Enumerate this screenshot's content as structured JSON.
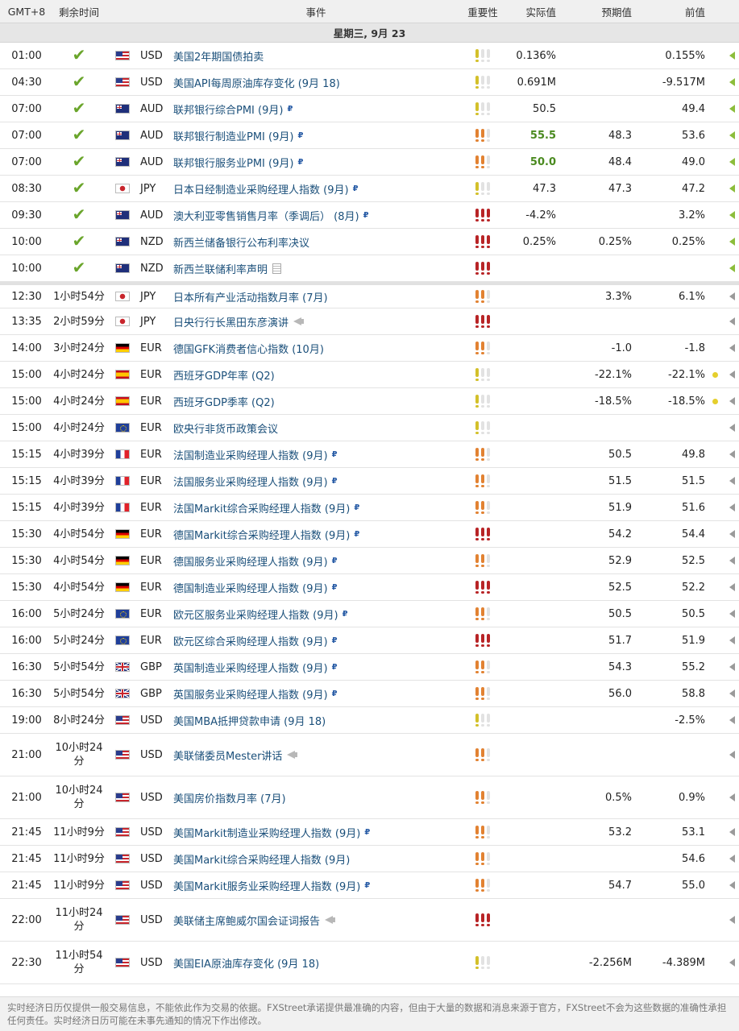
{
  "header": {
    "tz": "GMT+8",
    "remaining": "剩余时间",
    "event": "事件",
    "importance": "重要性",
    "actual": "实际值",
    "forecast": "预期值",
    "previous": "前值"
  },
  "day_label": "星期三, 9月 23",
  "rows": [
    {
      "time": "01:00",
      "rem": "",
      "done": true,
      "flag": "us",
      "cur": "USD",
      "event": "美国2年期国债拍卖",
      "mark": "",
      "imp": 1,
      "actual": "0.136%",
      "actual_green": false,
      "forecast": "",
      "previous": "0.155%",
      "dot": false,
      "arrow": "green"
    },
    {
      "time": "04:30",
      "rem": "",
      "done": true,
      "flag": "us",
      "cur": "USD",
      "event": "美国API每周原油库存变化 (9月 18)",
      "mark": "",
      "imp": 1,
      "actual": "0.691M",
      "actual_green": false,
      "forecast": "",
      "previous": "-9.517M",
      "dot": false,
      "arrow": "green"
    },
    {
      "time": "07:00",
      "rem": "",
      "done": true,
      "flag": "au",
      "cur": "AUD",
      "event": "联邦银行综合PMI (9月)",
      "mark": "P",
      "imp": 1,
      "actual": "50.5",
      "actual_green": false,
      "forecast": "",
      "previous": "49.4",
      "dot": false,
      "arrow": "green"
    },
    {
      "time": "07:00",
      "rem": "",
      "done": true,
      "flag": "au",
      "cur": "AUD",
      "event": "联邦银行制造业PMI (9月)",
      "mark": "P",
      "imp": 2,
      "actual": "55.5",
      "actual_green": true,
      "forecast": "48.3",
      "previous": "53.6",
      "dot": false,
      "arrow": "green"
    },
    {
      "time": "07:00",
      "rem": "",
      "done": true,
      "flag": "au",
      "cur": "AUD",
      "event": "联邦银行服务业PMI (9月)",
      "mark": "P",
      "imp": 2,
      "actual": "50.0",
      "actual_green": true,
      "forecast": "48.4",
      "previous": "49.0",
      "dot": false,
      "arrow": "green"
    },
    {
      "time": "08:30",
      "rem": "",
      "done": true,
      "flag": "jp",
      "cur": "JPY",
      "event": "日本日经制造业采购经理人指数 (9月)",
      "mark": "P",
      "imp": 1,
      "actual": "47.3",
      "actual_green": false,
      "forecast": "47.3",
      "previous": "47.2",
      "dot": false,
      "arrow": "green"
    },
    {
      "time": "09:30",
      "rem": "",
      "done": true,
      "flag": "au",
      "cur": "AUD",
      "event": "澳大利亚零售销售月率（季调后） (8月)",
      "mark": "P",
      "imp": 3,
      "actual": "-4.2%",
      "actual_green": false,
      "forecast": "",
      "previous": "3.2%",
      "dot": false,
      "arrow": "green"
    },
    {
      "time": "10:00",
      "rem": "",
      "done": true,
      "flag": "nz",
      "cur": "NZD",
      "event": "新西兰储备银行公布利率决议",
      "mark": "",
      "imp": 3,
      "actual": "0.25%",
      "actual_green": false,
      "forecast": "0.25%",
      "previous": "0.25%",
      "dot": false,
      "arrow": "green"
    },
    {
      "time": "10:00",
      "rem": "",
      "done": true,
      "flag": "nz",
      "cur": "NZD",
      "event": "新西兰联储利率声明",
      "mark": "doc",
      "imp": 3,
      "actual": "",
      "actual_green": false,
      "forecast": "",
      "previous": "",
      "dot": false,
      "arrow": "green"
    },
    {
      "time": "12:30",
      "rem": "1小时54分",
      "done": false,
      "flag": "jp",
      "cur": "JPY",
      "event": "日本所有产业活动指数月率 (7月)",
      "mark": "",
      "imp": 2,
      "actual": "",
      "actual_green": false,
      "forecast": "3.3%",
      "previous": "6.1%",
      "dot": false,
      "arrow": "gray",
      "sep": true
    },
    {
      "time": "13:35",
      "rem": "2小时59分",
      "done": false,
      "flag": "jp",
      "cur": "JPY",
      "event": "日央行行长黑田东彦演讲",
      "mark": "mega",
      "imp": 3,
      "actual": "",
      "actual_green": false,
      "forecast": "",
      "previous": "",
      "dot": false,
      "arrow": "gray"
    },
    {
      "time": "14:00",
      "rem": "3小时24分",
      "done": false,
      "flag": "de",
      "cur": "EUR",
      "event": "德国GFK消费者信心指数 (10月)",
      "mark": "",
      "imp": 2,
      "actual": "",
      "actual_green": false,
      "forecast": "-1.0",
      "previous": "-1.8",
      "dot": false,
      "arrow": "gray"
    },
    {
      "time": "15:00",
      "rem": "4小时24分",
      "done": false,
      "flag": "es",
      "cur": "EUR",
      "event": "西班牙GDP年率 (Q2)",
      "mark": "",
      "imp": 1,
      "actual": "",
      "actual_green": false,
      "forecast": "-22.1%",
      "previous": "-22.1%",
      "dot": true,
      "arrow": "gray"
    },
    {
      "time": "15:00",
      "rem": "4小时24分",
      "done": false,
      "flag": "es",
      "cur": "EUR",
      "event": "西班牙GDP季率 (Q2)",
      "mark": "",
      "imp": 1,
      "actual": "",
      "actual_green": false,
      "forecast": "-18.5%",
      "previous": "-18.5%",
      "dot": true,
      "arrow": "gray"
    },
    {
      "time": "15:00",
      "rem": "4小时24分",
      "done": false,
      "flag": "eu",
      "cur": "EUR",
      "event": "欧央行非货币政策会议",
      "mark": "",
      "imp": 1,
      "actual": "",
      "actual_green": false,
      "forecast": "",
      "previous": "",
      "dot": false,
      "arrow": "gray"
    },
    {
      "time": "15:15",
      "rem": "4小时39分",
      "done": false,
      "flag": "fr",
      "cur": "EUR",
      "event": "法国制造业采购经理人指数 (9月)",
      "mark": "P",
      "imp": 2,
      "actual": "",
      "actual_green": false,
      "forecast": "50.5",
      "previous": "49.8",
      "dot": false,
      "arrow": "gray"
    },
    {
      "time": "15:15",
      "rem": "4小时39分",
      "done": false,
      "flag": "fr",
      "cur": "EUR",
      "event": "法国服务业采购经理人指数 (9月)",
      "mark": "P",
      "imp": 2,
      "actual": "",
      "actual_green": false,
      "forecast": "51.5",
      "previous": "51.5",
      "dot": false,
      "arrow": "gray"
    },
    {
      "time": "15:15",
      "rem": "4小时39分",
      "done": false,
      "flag": "fr",
      "cur": "EUR",
      "event": "法国Markit综合采购经理人指数 (9月)",
      "mark": "P",
      "imp": 2,
      "actual": "",
      "actual_green": false,
      "forecast": "51.9",
      "previous": "51.6",
      "dot": false,
      "arrow": "gray"
    },
    {
      "time": "15:30",
      "rem": "4小时54分",
      "done": false,
      "flag": "de",
      "cur": "EUR",
      "event": "德国Markit综合采购经理人指数 (9月)",
      "mark": "P",
      "imp": 3,
      "actual": "",
      "actual_green": false,
      "forecast": "54.2",
      "previous": "54.4",
      "dot": false,
      "arrow": "gray"
    },
    {
      "time": "15:30",
      "rem": "4小时54分",
      "done": false,
      "flag": "de",
      "cur": "EUR",
      "event": "德国服务业采购经理人指数 (9月)",
      "mark": "P",
      "imp": 2,
      "actual": "",
      "actual_green": false,
      "forecast": "52.9",
      "previous": "52.5",
      "dot": false,
      "arrow": "gray"
    },
    {
      "time": "15:30",
      "rem": "4小时54分",
      "done": false,
      "flag": "de",
      "cur": "EUR",
      "event": "德国制造业采购经理人指数 (9月)",
      "mark": "P",
      "imp": 3,
      "actual": "",
      "actual_green": false,
      "forecast": "52.5",
      "previous": "52.2",
      "dot": false,
      "arrow": "gray"
    },
    {
      "time": "16:00",
      "rem": "5小时24分",
      "done": false,
      "flag": "eu",
      "cur": "EUR",
      "event": "欧元区服务业采购经理人指数 (9月)",
      "mark": "P",
      "imp": 2,
      "actual": "",
      "actual_green": false,
      "forecast": "50.5",
      "previous": "50.5",
      "dot": false,
      "arrow": "gray"
    },
    {
      "time": "16:00",
      "rem": "5小时24分",
      "done": false,
      "flag": "eu",
      "cur": "EUR",
      "event": "欧元区综合采购经理人指数 (9月)",
      "mark": "P",
      "imp": 3,
      "actual": "",
      "actual_green": false,
      "forecast": "51.7",
      "previous": "51.9",
      "dot": false,
      "arrow": "gray"
    },
    {
      "time": "16:30",
      "rem": "5小时54分",
      "done": false,
      "flag": "gb",
      "cur": "GBP",
      "event": "英国制造业采购经理人指数 (9月)",
      "mark": "P",
      "imp": 2,
      "actual": "",
      "actual_green": false,
      "forecast": "54.3",
      "previous": "55.2",
      "dot": false,
      "arrow": "gray"
    },
    {
      "time": "16:30",
      "rem": "5小时54分",
      "done": false,
      "flag": "gb",
      "cur": "GBP",
      "event": "英国服务业采购经理人指数 (9月)",
      "mark": "P",
      "imp": 2,
      "actual": "",
      "actual_green": false,
      "forecast": "56.0",
      "previous": "58.8",
      "dot": false,
      "arrow": "gray"
    },
    {
      "time": "19:00",
      "rem": "8小时24分",
      "done": false,
      "flag": "us",
      "cur": "USD",
      "event": "美国MBA抵押贷款申请 (9月 18)",
      "mark": "",
      "imp": 1,
      "actual": "",
      "actual_green": false,
      "forecast": "",
      "previous": "-2.5%",
      "dot": false,
      "arrow": "gray"
    },
    {
      "time": "21:00",
      "rem": "10小时24分",
      "done": false,
      "flag": "us",
      "cur": "USD",
      "event": "美联储委员Mester讲话",
      "mark": "mega",
      "imp": 2,
      "actual": "",
      "actual_green": false,
      "forecast": "",
      "previous": "",
      "dot": false,
      "arrow": "gray",
      "tall": true
    },
    {
      "time": "21:00",
      "rem": "10小时24分",
      "done": false,
      "flag": "us",
      "cur": "USD",
      "event": "美国房价指数月率 (7月)",
      "mark": "",
      "imp": 2,
      "actual": "",
      "actual_green": false,
      "forecast": "0.5%",
      "previous": "0.9%",
      "dot": false,
      "arrow": "gray",
      "tall": true
    },
    {
      "time": "21:45",
      "rem": "11小时9分",
      "done": false,
      "flag": "us",
      "cur": "USD",
      "event": "美国Markit制造业采购经理人指数 (9月)",
      "mark": "P",
      "imp": 2,
      "actual": "",
      "actual_green": false,
      "forecast": "53.2",
      "previous": "53.1",
      "dot": false,
      "arrow": "gray"
    },
    {
      "time": "21:45",
      "rem": "11小时9分",
      "done": false,
      "flag": "us",
      "cur": "USD",
      "event": "美国Markit综合采购经理人指数 (9月)",
      "mark": "",
      "imp": 2,
      "actual": "",
      "actual_green": false,
      "forecast": "",
      "previous": "54.6",
      "dot": false,
      "arrow": "gray"
    },
    {
      "time": "21:45",
      "rem": "11小时9分",
      "done": false,
      "flag": "us",
      "cur": "USD",
      "event": "美国Markit服务业采购经理人指数 (9月)",
      "mark": "P",
      "imp": 2,
      "actual": "",
      "actual_green": false,
      "forecast": "54.7",
      "previous": "55.0",
      "dot": false,
      "arrow": "gray"
    },
    {
      "time": "22:00",
      "rem": "11小时24分",
      "done": false,
      "flag": "us",
      "cur": "USD",
      "event": "美联储主席鲍威尔国会证词报告",
      "mark": "mega",
      "imp": 3,
      "actual": "",
      "actual_green": false,
      "forecast": "",
      "previous": "",
      "dot": false,
      "arrow": "gray",
      "tall": true
    },
    {
      "time": "22:30",
      "rem": "11小时54分",
      "done": false,
      "flag": "us",
      "cur": "USD",
      "event": "美国EIA原油库存变化 (9月 18)",
      "mark": "",
      "imp": 1,
      "actual": "",
      "actual_green": false,
      "forecast": "-2.256M",
      "previous": "-4.389M",
      "dot": false,
      "arrow": "gray",
      "tall": true
    }
  ],
  "footer": "实时经济日历仅提供一般交易信息，不能依此作为交易的依据。FXStreet承诺提供最准确的内容，但由于大量的数据和消息来源于官方，FXStreet不会为这些数据的准确性承担任何责任。实时经济日历可能在未事先通知的情况下作出修改。",
  "icons": {
    "done": "checkmark-icon",
    "preliminary": "p-icon",
    "document": "document-icon",
    "speech": "megaphone-icon",
    "expand": "arrow-left-icon",
    "alert": "dot-icon"
  },
  "colors": {
    "imp1": "#d3c02a",
    "imp2": "#e28232",
    "imp3": "#b82426",
    "actual_better": "#4a8a1f",
    "check": "#6aa52b",
    "event_link": "#1a4f7a"
  }
}
